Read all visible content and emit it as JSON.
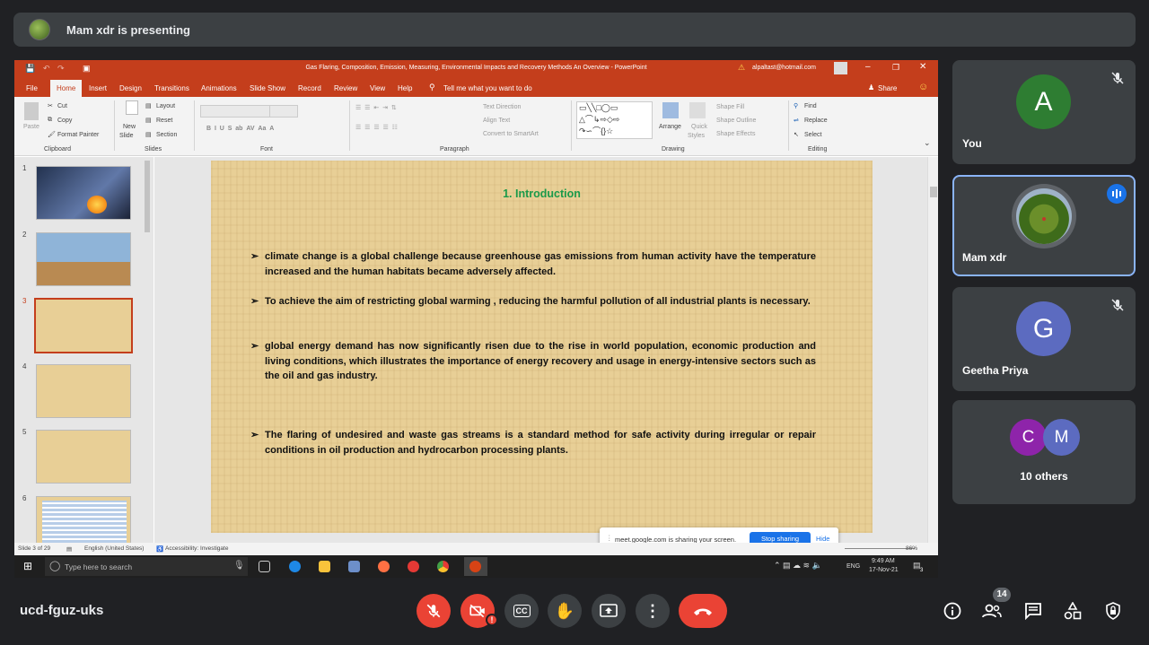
{
  "presenter": {
    "text": "Mam xdr is presenting"
  },
  "ppt": {
    "window_title": "Gas Flaring, Composition, Emission, Measuring, Environmental Impacts and Recovery Methods An Overview  -  PowerPoint",
    "account": "alpaltast@hotmail.com",
    "tabs": [
      "File",
      "Home",
      "Insert",
      "Design",
      "Transitions",
      "Animations",
      "Slide Show",
      "Record",
      "Review",
      "View",
      "Help"
    ],
    "tell_me": "Tell me what you want to do",
    "share": "Share",
    "ribbon": {
      "paste": "Paste",
      "cut": "Cut",
      "copy": "Copy",
      "format_painter": "Format Painter",
      "clipboard": "Clipboard",
      "new_slide": "New",
      "new_slide2": "Slide",
      "layout": "Layout",
      "reset": "Reset",
      "section": "Section",
      "slides": "Slides",
      "font": "Font",
      "paragraph": "Paragraph",
      "text_direction": "Text Direction",
      "align_text": "Align Text",
      "convert_smartart": "Convert to SmartArt",
      "arrange": "Arrange",
      "quick_styles": "Quick",
      "quick_styles2": "Styles",
      "shape_fill": "Shape Fill",
      "shape_outline": "Shape Outline",
      "shape_effects": "Shape Effects",
      "drawing": "Drawing",
      "find": "Find",
      "replace": "Replace",
      "select": "Select",
      "editing": "Editing"
    },
    "thumbnail_numbers": [
      "1",
      "2",
      "3",
      "4",
      "5",
      "6"
    ],
    "slide": {
      "title": "1. Introduction",
      "bullets": [
        "climate change is a global challenge because greenhouse gas emissions from human activity have the temperature increased and the human habitats became adversely affected.",
        "To achieve the aim of restricting global warming , reducing the harmful pollution of all industrial plants is necessary.",
        "global energy demand has now significantly risen due to the rise in world population, economic production and living conditions, which illustrates the importance of energy recovery and usage in energy-intensive sectors such as the oil and gas industry.",
        "The flaring of undesired and waste gas streams is a standard method for safe activity during irregular or repair conditions in oil production and hydrocarbon processing plants."
      ]
    },
    "status": {
      "slide_of": "Slide 3 of 29",
      "language": "English (United States)",
      "accessibility": "Accessibility: Investigate",
      "zoom": "86%"
    },
    "share_popup": {
      "text": "meet.google.com is sharing your screen.",
      "stop": "Stop sharing",
      "hide": "Hide"
    },
    "taskbar": {
      "search_placeholder": "Type here to search",
      "lang": "ENG",
      "time": "9:49 AM",
      "date": "17-Nov-21",
      "notif": "3"
    }
  },
  "participants": [
    {
      "name": "You",
      "initial": "A",
      "color": "#2e7d32"
    },
    {
      "name": "Mam xdr"
    },
    {
      "name": "Geetha Priya",
      "initial": "G",
      "color": "#5c6bc0"
    },
    {
      "name": "10 others",
      "initials": [
        "C",
        "M"
      ],
      "colors": [
        "#8e24aa",
        "#5c6bc0"
      ]
    }
  ],
  "meeting": {
    "code": "ucd-fguz-uks",
    "people_count": "14"
  }
}
